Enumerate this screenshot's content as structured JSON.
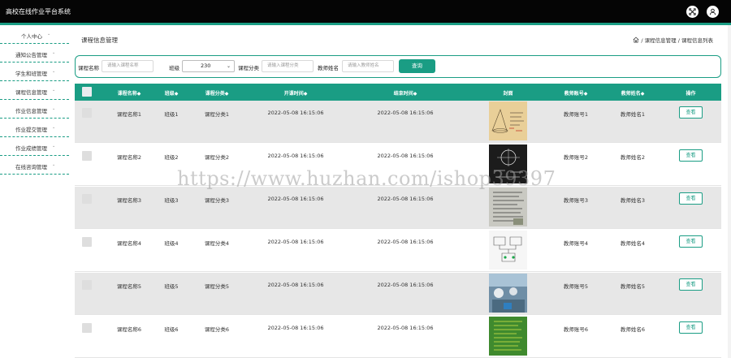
{
  "app": {
    "title": "高校在线作业平台系统"
  },
  "sidebar": {
    "items": [
      {
        "label": "个人中心"
      },
      {
        "label": "通知公告管理"
      },
      {
        "label": "学生和班管理"
      },
      {
        "label": "课程信息管理"
      },
      {
        "label": "作业信息管理"
      },
      {
        "label": "作业提交管理"
      },
      {
        "label": "作业成绩管理"
      },
      {
        "label": "在线咨询管理"
      }
    ]
  },
  "page": {
    "title": "课程信息管理",
    "breadcrumb": [
      "课程信息管理",
      "课程信息列表"
    ]
  },
  "search": {
    "course_name_label": "课程名称",
    "course_name_placeholder": "请输入课程名称",
    "class_label": "班级",
    "class_value": "230",
    "category_label": "课程分类",
    "category_placeholder": "请输入课程分类",
    "teacher_label": "教师姓名",
    "teacher_placeholder": "请输入教师姓名",
    "query_button": "查询"
  },
  "table": {
    "headers": [
      "课程名称◆",
      "班级◆",
      "课程分类◆",
      "开课时间◆",
      "结束时间◆",
      "封面",
      "教师账号◆",
      "教师姓名◆",
      "操作"
    ],
    "view_label": "查看",
    "rows": [
      {
        "name": "课程名称1",
        "cls": "班级1",
        "category": "课程分类1",
        "start": "2022-05-08 16:15:06",
        "end": "2022-05-08 16:15:06",
        "account": "教师账号1",
        "teacher": "教师姓名1"
      },
      {
        "name": "课程名称2",
        "cls": "班级2",
        "category": "课程分类2",
        "start": "2022-05-08 16:15:06",
        "end": "2022-05-08 16:15:06",
        "account": "教师账号2",
        "teacher": "教师姓名2"
      },
      {
        "name": "课程名称3",
        "cls": "班级3",
        "category": "课程分类3",
        "start": "2022-05-08 16:15:06",
        "end": "2022-05-08 16:15:06",
        "account": "教师账号3",
        "teacher": "教师姓名3"
      },
      {
        "name": "课程名称4",
        "cls": "班级4",
        "category": "课程分类4",
        "start": "2022-05-08 16:15:06",
        "end": "2022-05-08 16:15:06",
        "account": "教师账号4",
        "teacher": "教师姓名4"
      },
      {
        "name": "课程名称5",
        "cls": "班级5",
        "category": "课程分类5",
        "start": "2022-05-08 16:15:06",
        "end": "2022-05-08 16:15:06",
        "account": "教师账号5",
        "teacher": "教师姓名5"
      },
      {
        "name": "课程名称6",
        "cls": "班级6",
        "category": "课程分类6",
        "start": "2022-05-08 16:15:06",
        "end": "2022-05-08 16:15:06",
        "account": "教师账号6",
        "teacher": "教师姓名6"
      }
    ]
  },
  "watermark": "https://www.huzhan.com/ishop39397",
  "icons": {
    "fullscreen": "expand-icon",
    "user": "user-avatar-icon",
    "home": "home-icon",
    "caret": "caret-down-icon"
  },
  "colors": {
    "accent": "#1a9d84",
    "topbar": "#050505",
    "row_alt": "#e7e7e7"
  }
}
